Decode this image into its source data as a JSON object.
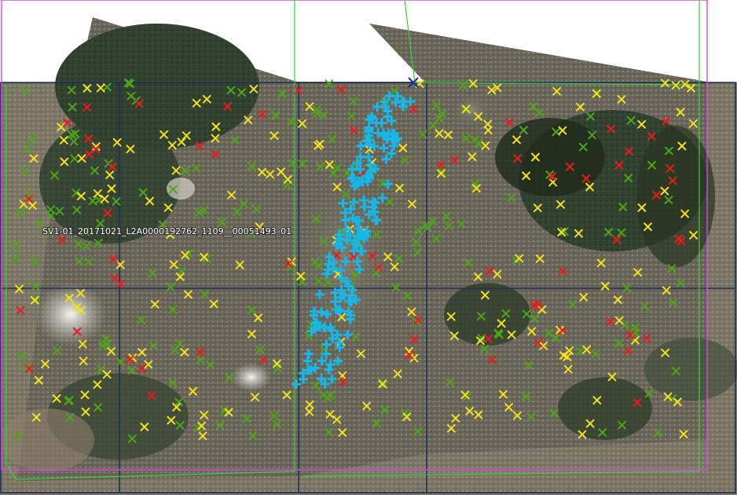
{
  "map": {
    "scene_label": "SV1-01_20171021_L2A0000192762_1109__00051493_01",
    "colors": {
      "background": "#ffffff",
      "tile_grid": "#1c2f57",
      "magenta_outline": "#d54be0",
      "green_outline": "#39d23a",
      "imagery_dark": "#2c3a2a",
      "imagery_urban": "#7a7566",
      "cyan_cluster": "#19b6e8"
    },
    "marker_legend": [
      {
        "color": "#e81c1c",
        "icon": "red-x-marker"
      },
      {
        "color": "#f2e024",
        "icon": "yellow-x-marker"
      },
      {
        "color": "#4fa51a",
        "icon": "green-x-marker"
      },
      {
        "color": "#19b6e8",
        "icon": "cyan-plus-marker"
      },
      {
        "color": "#1a2a9e",
        "icon": "blue-x-marker"
      }
    ]
  }
}
